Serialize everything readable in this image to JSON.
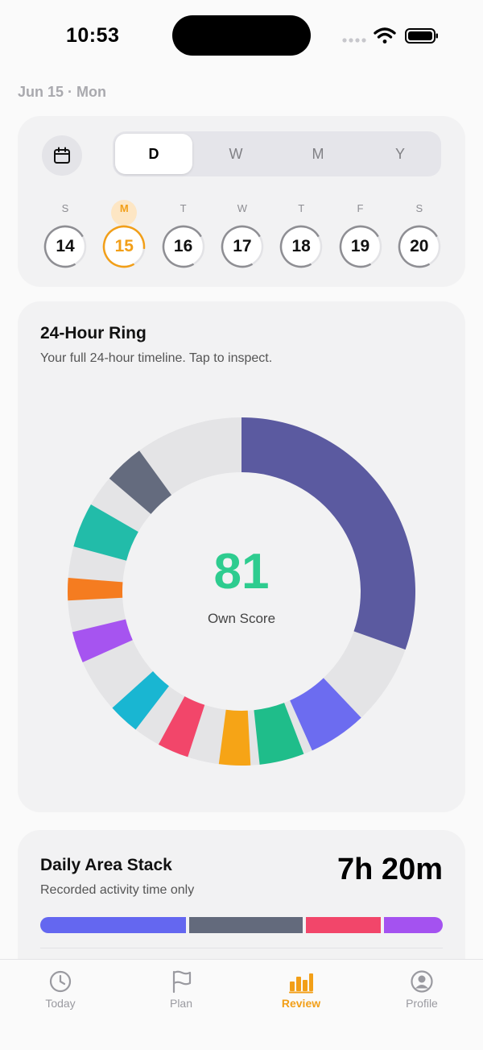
{
  "status": {
    "time": "10:53"
  },
  "header": {
    "date": "Jun 15 · Mon"
  },
  "period": {
    "options": [
      "D",
      "W",
      "M",
      "Y"
    ],
    "selected": "D"
  },
  "week": {
    "days": [
      {
        "letter": "S",
        "num": "14",
        "progress": 0.75
      },
      {
        "letter": "M",
        "num": "15",
        "progress": 0.85,
        "selected": true
      },
      {
        "letter": "T",
        "num": "16",
        "progress": 0.75
      },
      {
        "letter": "W",
        "num": "17",
        "progress": 0.75
      },
      {
        "letter": "T",
        "num": "18",
        "progress": 0.75
      },
      {
        "letter": "F",
        "num": "19",
        "progress": 0.75
      },
      {
        "letter": "S",
        "num": "20",
        "progress": 0.75
      }
    ]
  },
  "ring": {
    "title": "24-Hour Ring",
    "subtitle": "Your full 24-hour timeline. Tap to inspect.",
    "score": "81",
    "score_label": "Own Score",
    "track_color": "#e4e4e6",
    "segments": [
      {
        "start_hour": 0.0,
        "end_hour": 7.3,
        "color": "#5b5aa0"
      },
      {
        "start_hour": 9.1,
        "end_hour": 10.4,
        "color": "#6c6cf0"
      },
      {
        "start_hour": 10.6,
        "end_hour": 11.6,
        "color": "#1fbd8a"
      },
      {
        "start_hour": 11.8,
        "end_hour": 12.5,
        "color": "#f6a416"
      },
      {
        "start_hour": 13.2,
        "end_hour": 13.9,
        "color": "#f2466a"
      },
      {
        "start_hour": 14.5,
        "end_hour": 15.2,
        "color": "#19b6d2"
      },
      {
        "start_hour": 16.4,
        "end_hour": 17.1,
        "color": "#a654f0"
      },
      {
        "start_hour": 17.8,
        "end_hour": 18.3,
        "color": "#f57c20"
      },
      {
        "start_hour": 19.0,
        "end_hour": 20.0,
        "color": "#22bca9"
      },
      {
        "start_hour": 20.7,
        "end_hour": 21.6,
        "color": "#646b7e"
      }
    ]
  },
  "stack": {
    "title": "Daily Area Stack",
    "subtitle": "Recorded activity time only",
    "total": "7h 20m",
    "segments": [
      {
        "fraction": 0.37,
        "color": "#6467f0"
      },
      {
        "fraction": 0.29,
        "color": "#636a7c"
      },
      {
        "fraction": 0.19,
        "color": "#f2466a"
      },
      {
        "fraction": 0.15,
        "color": "#a452f0"
      }
    ]
  },
  "tabs": [
    {
      "label": "Today",
      "icon": "clock-icon"
    },
    {
      "label": "Plan",
      "icon": "flag-icon"
    },
    {
      "label": "Review",
      "icon": "chart-icon",
      "active": true
    },
    {
      "label": "Profile",
      "icon": "person-icon"
    }
  ]
}
